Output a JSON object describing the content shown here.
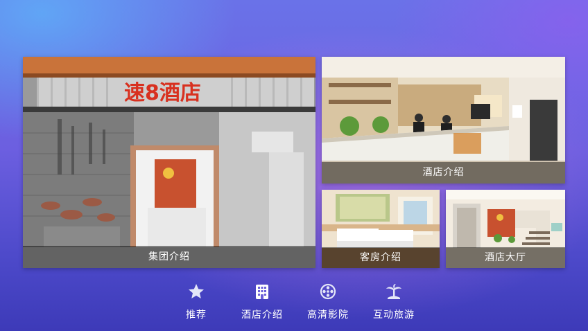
{
  "tiles": {
    "group": {
      "caption": "集团介绍",
      "sign_text": "速8酒店"
    },
    "hotel": {
      "caption": "酒店介绍"
    },
    "room": {
      "caption": "客房介绍"
    },
    "lobby": {
      "caption": "酒店大厅"
    }
  },
  "nav": {
    "items": [
      {
        "label": "推荐",
        "icon": "star-icon"
      },
      {
        "label": "酒店介绍",
        "icon": "building-icon",
        "selected": true
      },
      {
        "label": "高清影院",
        "icon": "film-reel-icon"
      },
      {
        "label": "互动旅游",
        "icon": "palm-tree-icon"
      }
    ]
  },
  "colors": {
    "accent_red": "#d8301f",
    "caption_bg": "rgba(0,0,0,0.45)"
  }
}
